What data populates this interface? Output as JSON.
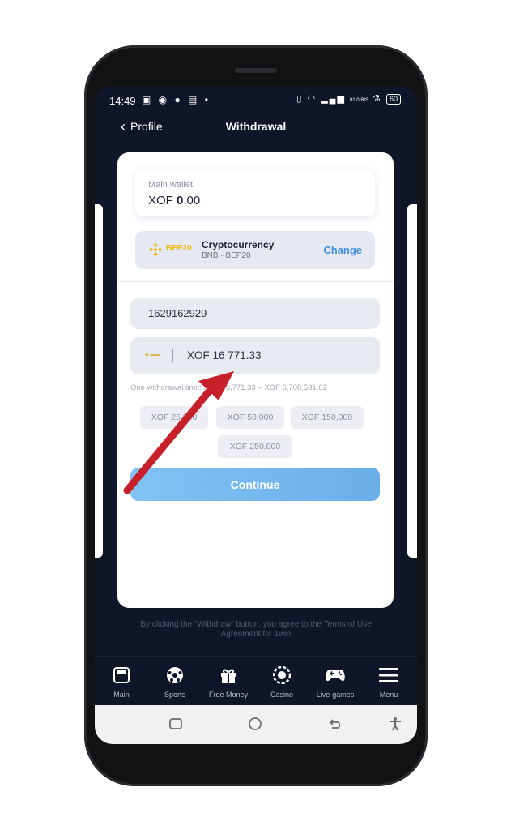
{
  "status_bar": {
    "time": "14:49",
    "battery": "60",
    "net_speed": "81.0 B/S"
  },
  "header": {
    "back_label": "Profile",
    "title": "Withdrawal"
  },
  "wallet": {
    "label": "Main wallet",
    "currency": "XOF",
    "amount_int": "0",
    "amount_dec": ".00"
  },
  "method": {
    "badge": "BEP20",
    "name": "Cryptocurrency",
    "sub": "BNB - BEP20",
    "change_label": "Change"
  },
  "form": {
    "address": "1629162929",
    "amount": "XOF 16 771.33",
    "limit_text": "One withdrawal limit: XOF 16,771.33 – XOF 6,708,531.62",
    "chips": [
      "XOF 25,000",
      "XOF 50,000",
      "XOF 150,000",
      "XOF 250,000"
    ],
    "continue_label": "Continue"
  },
  "terms": "By clicking the \"Withdraw\" button, you agree to the Terms of Use Agreement for 1win",
  "tabs": [
    {
      "label": "Main",
      "icon": "main-icon"
    },
    {
      "label": "Sports",
      "icon": "soccer-ball-icon"
    },
    {
      "label": "Free Money",
      "icon": "gift-icon"
    },
    {
      "label": "Casino",
      "icon": "casino-chip-icon"
    },
    {
      "label": "Live-games",
      "icon": "gamepad-icon"
    },
    {
      "label": "Menu",
      "icon": "hamburger-menu-icon"
    }
  ],
  "colors": {
    "accent": "#3d8fe0",
    "screen_bg": "#0f1629",
    "arrow": "#c8202a",
    "bep20": "#f0b90b"
  }
}
